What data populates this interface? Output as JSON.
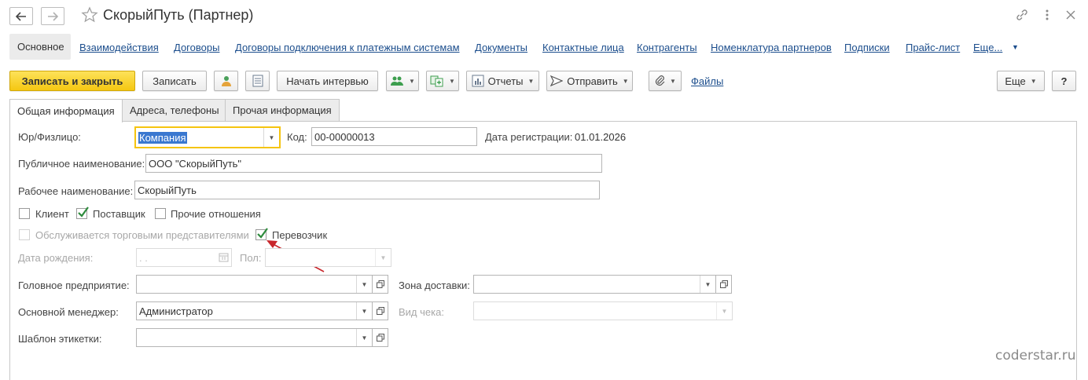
{
  "window": {
    "title": "СкорыйПуть (Партнер)"
  },
  "panel": {
    "active": "Основное",
    "links": [
      "Взаимодействия",
      "Договоры",
      "Договоры подключения к платежным системам",
      "Документы",
      "Контактные лица",
      "Контрагенты",
      "Номенклатура партнеров",
      "Подписки",
      "Прайс-лист",
      "Еще..."
    ]
  },
  "toolbar": {
    "save_close": "Записать и закрыть",
    "save": "Записать",
    "start_interview": "Начать интервью",
    "reports": "Отчеты",
    "send": "Отправить",
    "files": "Файлы",
    "more": "Еще",
    "help": "?"
  },
  "tabs": [
    "Общая информация",
    "Адреса, телефоны",
    "Прочая информация"
  ],
  "form": {
    "legal_type_label": "Юр/Физлицо:",
    "legal_type_value": "Компания",
    "code_label": "Код:",
    "code_value": "00-00000013",
    "reg_date_label": "Дата регистрации:",
    "reg_date_value": "01.01.2026",
    "public_name_label": "Публичное наименование:",
    "public_name_value": "ООО \"СкорыйПуть\"",
    "work_name_label": "Рабочее наименование:",
    "work_name_value": "СкорыйПуть",
    "client_label": "Клиент",
    "client_checked": false,
    "supplier_label": "Поставщик",
    "supplier_checked": true,
    "other_label": "Прочие отношения",
    "other_checked": false,
    "sales_rep_label": "Обслуживается торговыми представителями",
    "sales_rep_checked": false,
    "carrier_label": "Перевозчик",
    "carrier_checked": true,
    "birth_date_label": "Дата рождения:",
    "birth_date_value": " .  .",
    "gender_label": "Пол:",
    "head_company_label": "Головное предприятие:",
    "delivery_zone_label": "Зона доставки:",
    "manager_label": "Основной менеджер:",
    "manager_value": "Администратор",
    "receipt_type_label": "Вид чека:",
    "label_template_label": "Шаблон этикетки:"
  },
  "watermark": "coderstar.ru",
  "colors": {
    "primary_button": "#f5c711",
    "link": "#1c4e8d",
    "focus_border": "#f5c40f",
    "selection": "#3a78d0",
    "check": "#2e8b3d",
    "arrow": "#c8262c"
  }
}
